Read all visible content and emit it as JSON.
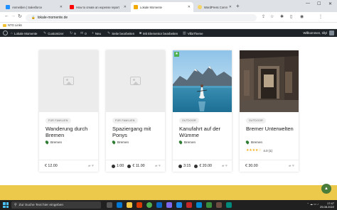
{
  "browser": {
    "tabs": [
      {
        "label": "Anmelden | Salesforce",
        "color": "#1e90ff",
        "active": false
      },
      {
        "label": "How to create an expense report",
        "color": "#ff0000",
        "active": false
      },
      {
        "label": "Lokale Momente",
        "color": "#f2a900",
        "active": true
      },
      {
        "label": "WordPress Community",
        "color": "#f6d365",
        "active": false
      }
    ],
    "url": "lokale-momente.de",
    "bookmark": "NTG Links"
  },
  "admin_bar": {
    "site_name": "Lokale Momente",
    "customize": "Customizer",
    "comments": "9",
    "comments_count": "0",
    "new": "Neu",
    "edit_page": "Seite bearbeiten",
    "elementor": "Mit Elementor bearbeiten",
    "villa": "VillaTheme",
    "greeting": "Willkommen, tillyl"
  },
  "cards": [
    {
      "badge": "FÜR FAMILIEN",
      "title": "Wanderung durch Bremen",
      "location": "Bremen",
      "price": "€ 12.00",
      "duration": ""
    },
    {
      "badge": "FÜR FAMILIEN",
      "title": "Spaziergang mit Ponys",
      "location": "Bremen",
      "price": "€ 11.00",
      "duration": "1:00"
    },
    {
      "badge": "OUTDOOR",
      "title": "Kanufahrt auf der Wümme",
      "location": "Bremen",
      "price": "€ 20.00",
      "duration": "3:15"
    },
    {
      "badge": "OUTDOOR",
      "title": "Bremer Unterwelten",
      "location": "Bremen",
      "price": "€ 30.00",
      "duration": "",
      "rating": "4.0",
      "reviews": "(1)"
    }
  ],
  "taskbar": {
    "search_placeholder": "Zur Suche Text hier eingeben",
    "time": "17:47",
    "date": "25.08.2022"
  },
  "colors": {
    "accent_green": "#2e7d32",
    "yellow_band": "#ecc94b",
    "admin_bar": "#1d2327"
  }
}
